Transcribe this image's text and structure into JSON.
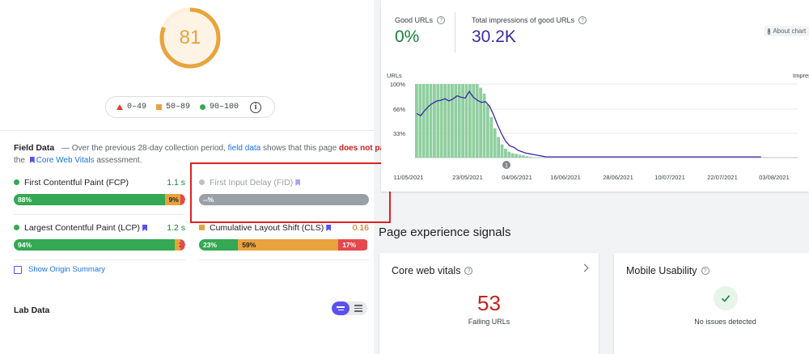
{
  "score": "81",
  "legend": {
    "fail": "0–49",
    "average": "50–89",
    "pass": "90–100",
    "info": "i"
  },
  "field_data": {
    "title": "Field Data",
    "desc_a": "— Over the previous 28-day collection period,",
    "link_field": "field data",
    "desc_b": "shows that this page",
    "fail_text": "does not pass",
    "desc_c": "the",
    "cwv_link": "Core Web Vitals",
    "desc_d": "assessment."
  },
  "metrics": {
    "fcp": {
      "name": "First Contentful Paint (FCP)",
      "value": "1.1 s",
      "good": "88%",
      "ni": "9%",
      "poor": "3%",
      "good_frac": 0.88,
      "ni_frac": 0.09,
      "poor_frac": 0.03
    },
    "fid": {
      "name": "First Input Delay (FID)",
      "value": "--%"
    },
    "lcp": {
      "name": "Largest Contentful Paint (LCP)",
      "value": "1.2 s",
      "good": "94%",
      "ni": "3%",
      "poor": "3%",
      "good_frac": 0.94,
      "ni_frac": 0.03,
      "poor_frac": 0.03
    },
    "cls": {
      "name": "Cumulative Layout Shift (CLS)",
      "value": "0.16",
      "good": "23%",
      "ni": "59%",
      "poor": "17%",
      "good_frac": 0.23,
      "ni_frac": 0.59,
      "poor_frac": 0.17
    }
  },
  "show_origin": "Show Origin Summary",
  "lab_data": "Lab Data",
  "search_console": {
    "good_urls_label": "Good URLs",
    "good_urls_value": "0%",
    "impressions_label": "Total impressions of good URLs",
    "impressions_value": "30.2K",
    "about": "About chart",
    "y_label_left": "URLs",
    "y_label_right": "Impressions",
    "annotation": "1"
  },
  "chart_data": {
    "type": "bar",
    "x_ticks": [
      "11/05/2021",
      "23/05/2021",
      "04/06/2021",
      "16/06/2021",
      "28/06/2021",
      "10/07/2021",
      "22/07/2021",
      "03/08/2021"
    ],
    "y_ticks": [
      "100%",
      "66%",
      "33%"
    ],
    "ylim": [
      0,
      100
    ],
    "bars": [
      100,
      100,
      100,
      100,
      100,
      100,
      100,
      100,
      100,
      100,
      100,
      100,
      100,
      100,
      100,
      100,
      100,
      100,
      95,
      87,
      72,
      55,
      40,
      28,
      18,
      12,
      8,
      6,
      5,
      4,
      3,
      2,
      1
    ],
    "line": [
      60,
      57,
      64,
      70,
      74,
      77,
      78,
      80,
      77,
      80,
      84,
      82,
      81,
      90,
      82,
      78,
      75,
      76,
      70,
      58,
      44,
      32,
      22,
      16,
      14,
      10,
      8,
      6,
      5,
      4,
      3,
      2,
      1,
      1,
      1,
      1,
      1,
      1,
      1,
      1,
      1,
      1,
      1,
      1,
      1,
      1,
      1,
      1,
      1,
      1,
      1,
      1,
      1,
      1,
      1,
      1,
      1,
      1,
      1,
      1,
      1,
      1,
      1,
      1,
      1,
      1,
      1,
      1,
      1,
      1,
      1,
      1,
      1,
      1,
      1,
      1,
      1,
      1,
      1,
      1,
      1,
      1,
      1,
      1,
      1,
      1
    ]
  },
  "page_experience": {
    "title": "Page experience signals",
    "cwv": {
      "title": "Core web vitals",
      "value": "53",
      "sub": "Failing URLs"
    },
    "mobile": {
      "title": "Mobile Usability",
      "sub": "No issues detected"
    }
  },
  "colors": {
    "good": "#34a853",
    "average": "#e8a33d",
    "poor": "#e5484d",
    "accent": "#5b50f0",
    "line": "#3b2aa8",
    "bar": "#8fcf9f"
  }
}
